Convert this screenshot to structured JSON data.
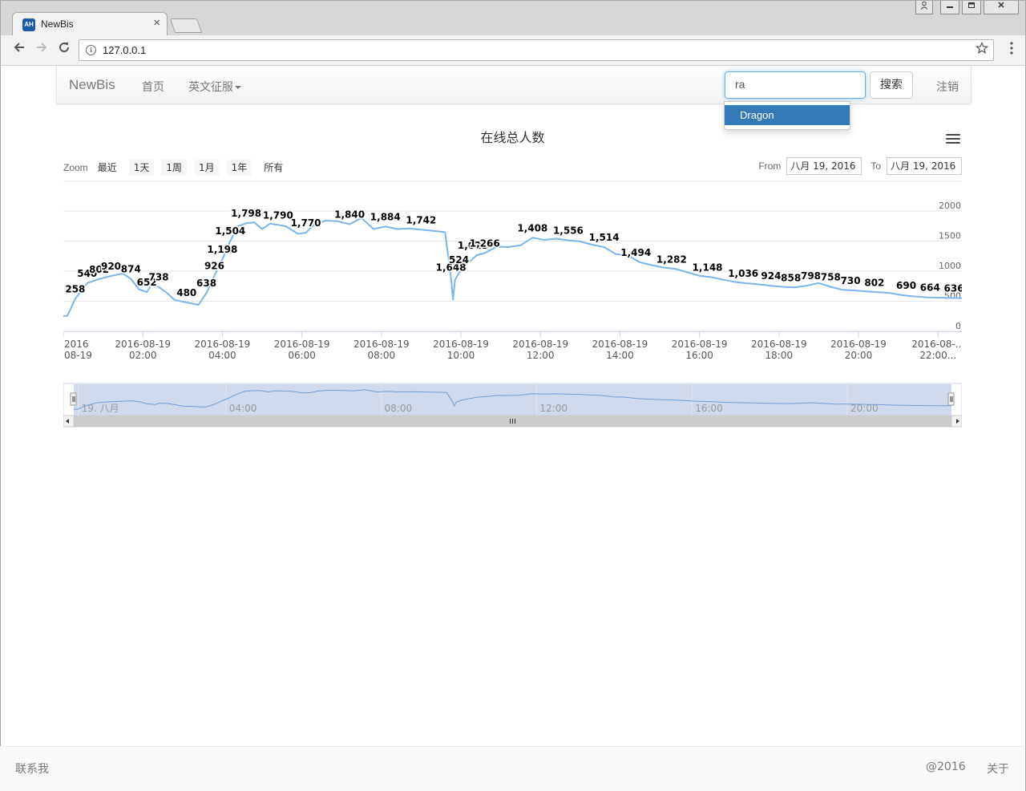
{
  "browser": {
    "tab_title": "NewBis",
    "tab_favicon": "AH",
    "close_glyph": "×",
    "url": "127.0.0.1"
  },
  "navbar": {
    "brand": "NewBis",
    "links": [
      "首页",
      "英文征服"
    ],
    "search_value": "ra",
    "search_button": "搜索",
    "logout": "注销",
    "autocomplete": [
      "Dragon"
    ]
  },
  "chart": {
    "title": "在线总人数",
    "zoom_label": "Zoom",
    "zoom_buttons": [
      "最近",
      "1天",
      "1周",
      "1月",
      "1年",
      "所有"
    ],
    "from_label": "From",
    "from_value": "八月 19, 2016",
    "to_label": "To",
    "to_value": "八月 19, 2016"
  },
  "chart_data": {
    "type": "line",
    "title": "在线总人数",
    "ylim": [
      0,
      2000
    ],
    "yticks": [
      0,
      500,
      1000,
      1500,
      2000
    ],
    "x_hours": [
      0,
      0.1,
      0.3,
      0.6,
      0.9,
      1.2,
      1.5,
      1.7,
      1.9,
      2.1,
      2.2,
      2.4,
      2.6,
      2.8,
      3.1,
      3.4,
      3.6,
      3.8,
      4.0,
      4.2,
      4.4,
      4.6,
      4.8,
      5.0,
      5.2,
      5.4,
      5.6,
      5.9,
      6.1,
      6.3,
      6.6,
      6.9,
      7.2,
      7.5,
      7.8,
      8.1,
      8.4,
      8.7,
      9.0,
      9.3,
      9.6,
      9.75,
      9.8,
      9.85,
      10.0,
      10.2,
      10.4,
      10.6,
      10.9,
      11.2,
      11.5,
      11.8,
      12.1,
      12.4,
      12.7,
      13.0,
      13.3,
      13.6,
      13.9,
      14.2,
      14.5,
      14.8,
      15.1,
      15.4,
      15.7,
      16.0,
      16.3,
      16.6,
      16.9,
      17.2,
      17.5,
      17.8,
      18.1,
      18.4,
      18.7,
      19.0,
      19.3,
      19.6,
      19.9,
      20.2,
      20.5,
      20.8,
      21.1,
      21.4,
      21.7,
      22.0,
      22.3,
      22.6
    ],
    "values": [
      258,
      258,
      540,
      802,
      870,
      920,
      960,
      874,
      700,
      652,
      760,
      738,
      640,
      520,
      480,
      440,
      638,
      926,
      1198,
      1504,
      1750,
      1798,
      1812,
      1700,
      1790,
      1770,
      1745,
      1620,
      1640,
      1770,
      1840,
      1830,
      1780,
      1884,
      1700,
      1742,
      1700,
      1710,
      1690,
      1670,
      1648,
      900,
      524,
      850,
      1028,
      1150,
      1266,
      1300,
      1408,
      1400,
      1430,
      1556,
      1520,
      1540,
      1514,
      1494,
      1440,
      1400,
      1282,
      1260,
      1148,
      1100,
      1060,
      1036,
      980,
      924,
      900,
      858,
      820,
      798,
      780,
      758,
      740,
      730,
      760,
      802,
      740,
      690,
      680,
      664,
      650,
      636,
      600,
      580,
      565,
      560,
      555,
      550
    ],
    "data_labels": [
      {
        "x": 0.3,
        "v": "258"
      },
      {
        "x": 0.6,
        "v": "540"
      },
      {
        "x": 0.9,
        "v": "802"
      },
      {
        "x": 1.2,
        "v": "920"
      },
      {
        "x": 1.7,
        "v": "874"
      },
      {
        "x": 2.1,
        "v": "652"
      },
      {
        "x": 2.4,
        "v": "738"
      },
      {
        "x": 3.1,
        "v": "480"
      },
      {
        "x": 3.6,
        "v": "638"
      },
      {
        "x": 3.8,
        "v": "926"
      },
      {
        "x": 4.0,
        "v": "1,198"
      },
      {
        "x": 4.2,
        "v": "1,504"
      },
      {
        "x": 4.6,
        "v": "1,798"
      },
      {
        "x": 5.4,
        "v": "1,790"
      },
      {
        "x": 6.1,
        "v": "1,770"
      },
      {
        "x": 7.2,
        "v": "1,840"
      },
      {
        "x": 8.1,
        "v": "1,884"
      },
      {
        "x": 9.0,
        "v": "1,742"
      },
      {
        "x": 9.75,
        "v": "1,648"
      },
      {
        "x": 9.95,
        "v": "524"
      },
      {
        "x": 10.3,
        "v": "1,028"
      },
      {
        "x": 10.6,
        "v": "1,266"
      },
      {
        "x": 11.8,
        "v": "1,408"
      },
      {
        "x": 12.7,
        "v": "1,556"
      },
      {
        "x": 13.6,
        "v": "1,514"
      },
      {
        "x": 14.4,
        "v": "1,494"
      },
      {
        "x": 15.3,
        "v": "1,282"
      },
      {
        "x": 16.2,
        "v": "1,148"
      },
      {
        "x": 17.1,
        "v": "1,036"
      },
      {
        "x": 17.8,
        "v": "924"
      },
      {
        "x": 18.3,
        "v": "858"
      },
      {
        "x": 18.8,
        "v": "798"
      },
      {
        "x": 19.3,
        "v": "758"
      },
      {
        "x": 19.8,
        "v": "730"
      },
      {
        "x": 20.4,
        "v": "802"
      },
      {
        "x": 21.2,
        "v": "690"
      },
      {
        "x": 21.8,
        "v": "664"
      },
      {
        "x": 22.4,
        "v": "636"
      }
    ],
    "x_ticks": [
      {
        "x": 0,
        "l1": "2016",
        "l2": "08-19"
      },
      {
        "x": 2,
        "l1": "2016-08-19",
        "l2": "02:00"
      },
      {
        "x": 4,
        "l1": "2016-08-19",
        "l2": "04:00"
      },
      {
        "x": 6,
        "l1": "2016-08-19",
        "l2": "06:00"
      },
      {
        "x": 8,
        "l1": "2016-08-19",
        "l2": "08:00"
      },
      {
        "x": 10,
        "l1": "2016-08-19",
        "l2": "10:00"
      },
      {
        "x": 12,
        "l1": "2016-08-19",
        "l2": "12:00"
      },
      {
        "x": 14,
        "l1": "2016-08-19",
        "l2": "14:00"
      },
      {
        "x": 16,
        "l1": "2016-08-19",
        "l2": "16:00"
      },
      {
        "x": 18,
        "l1": "2016-08-19",
        "l2": "18:00"
      },
      {
        "x": 20,
        "l1": "2016-08-19",
        "l2": "20:00"
      },
      {
        "x": 22,
        "l1": "2016-08-...",
        "l2": "22:00..."
      }
    ],
    "navigator_labels": [
      {
        "x": 0.2,
        "v": "19. 八月"
      },
      {
        "x": 4,
        "v": "04:00"
      },
      {
        "x": 8,
        "v": "08:00"
      },
      {
        "x": 12,
        "v": "12:00"
      },
      {
        "x": 16,
        "v": "16:00"
      },
      {
        "x": 20,
        "v": "20:00"
      }
    ],
    "series_color": "#7cb5ec",
    "grid": true
  },
  "footer": {
    "contact": "联系我",
    "copyright": "@2016",
    "about": "关于"
  }
}
